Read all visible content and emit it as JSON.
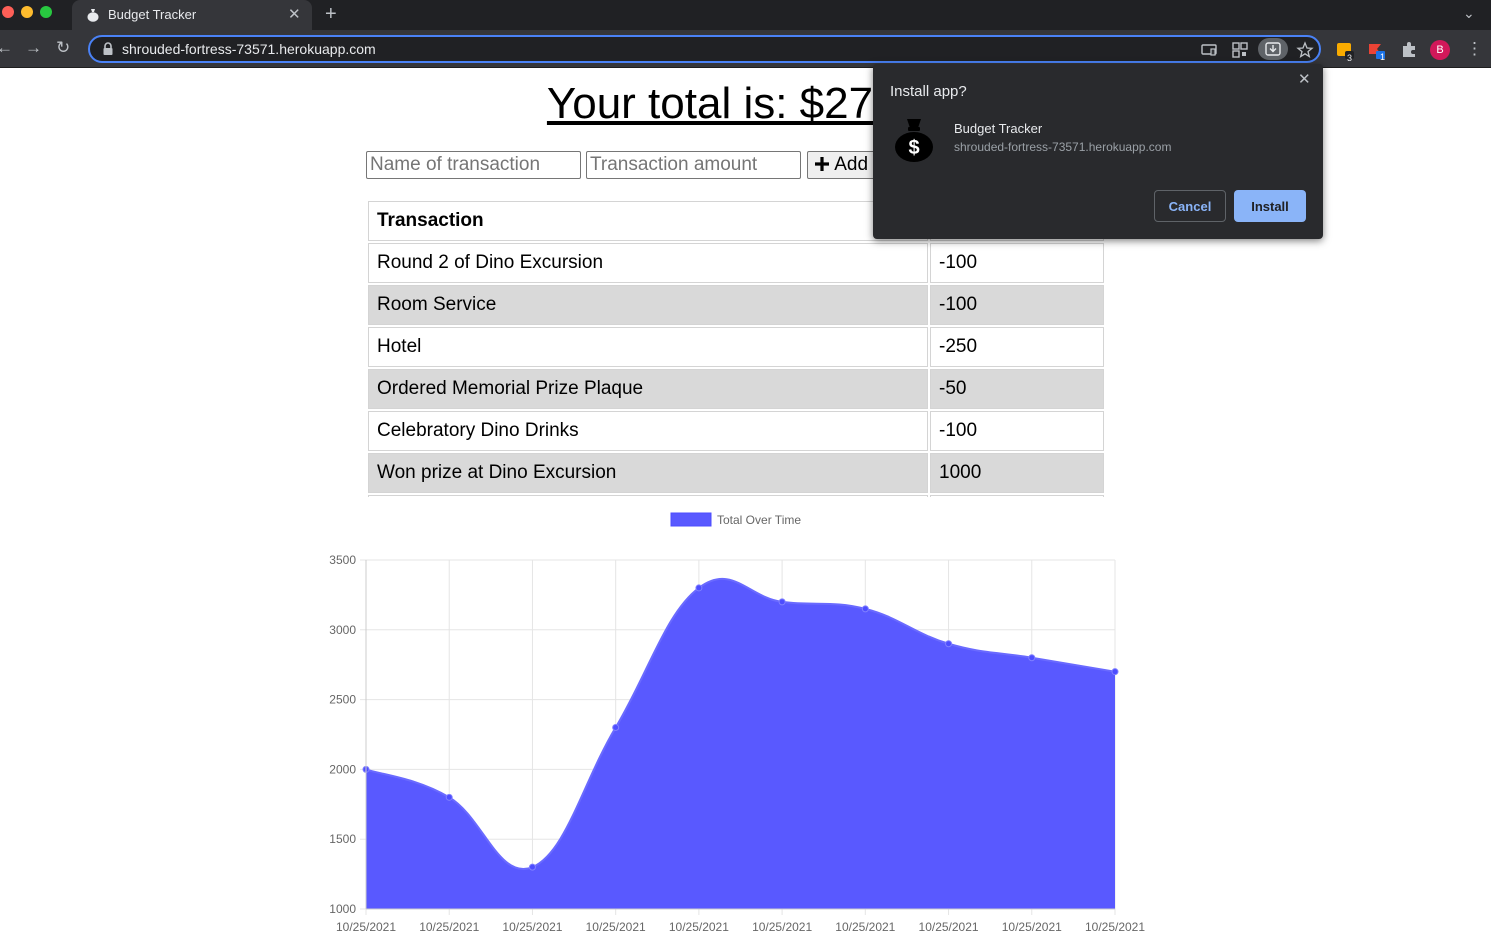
{
  "browser": {
    "tab_title": "Budget Tracker",
    "url": "shrouded-fortress-73571.herokuapp.com",
    "profile_initial": "B",
    "ext_badges": [
      "3",
      "1"
    ]
  },
  "page": {
    "total_label": "Your total is: $27",
    "form": {
      "name_placeholder": "Name of transaction",
      "amount_placeholder": "Transaction amount",
      "add_label": "Add"
    },
    "table": {
      "header": "Transaction",
      "rows": [
        {
          "name": "Round 2 of Dino Excursion",
          "amount": "-100"
        },
        {
          "name": "Room Service",
          "amount": "-100"
        },
        {
          "name": "Hotel",
          "amount": "-250"
        },
        {
          "name": "Ordered Memorial Prize Plaque",
          "amount": "-50"
        },
        {
          "name": "Celebratory Dino Drinks",
          "amount": "-100"
        },
        {
          "name": "Won prize at Dino Excursion",
          "amount": "1000"
        }
      ]
    }
  },
  "install_popup": {
    "title": "Install app?",
    "app_name": "Budget Tracker",
    "app_url": "shrouded-fortress-73571.herokuapp.com",
    "cancel_label": "Cancel",
    "install_label": "Install"
  },
  "chart_data": {
    "type": "area",
    "legend": "Total Over Time",
    "legend_position": "top",
    "grid": true,
    "x": [
      "10/25/2021",
      "10/25/2021",
      "10/25/2021",
      "10/25/2021",
      "10/25/2021",
      "10/25/2021",
      "10/25/2021",
      "10/25/2021",
      "10/25/2021",
      "10/25/2021"
    ],
    "series": [
      {
        "name": "Total Over Time",
        "values": [
          2000,
          1800,
          1300,
          2300,
          3300,
          3200,
          3150,
          2900,
          2800,
          2700
        ]
      }
    ],
    "ylim": [
      1000,
      3500
    ],
    "yticks": [
      1000,
      1500,
      2000,
      2500,
      3000,
      3500
    ],
    "fill_color": "#5959ff"
  }
}
